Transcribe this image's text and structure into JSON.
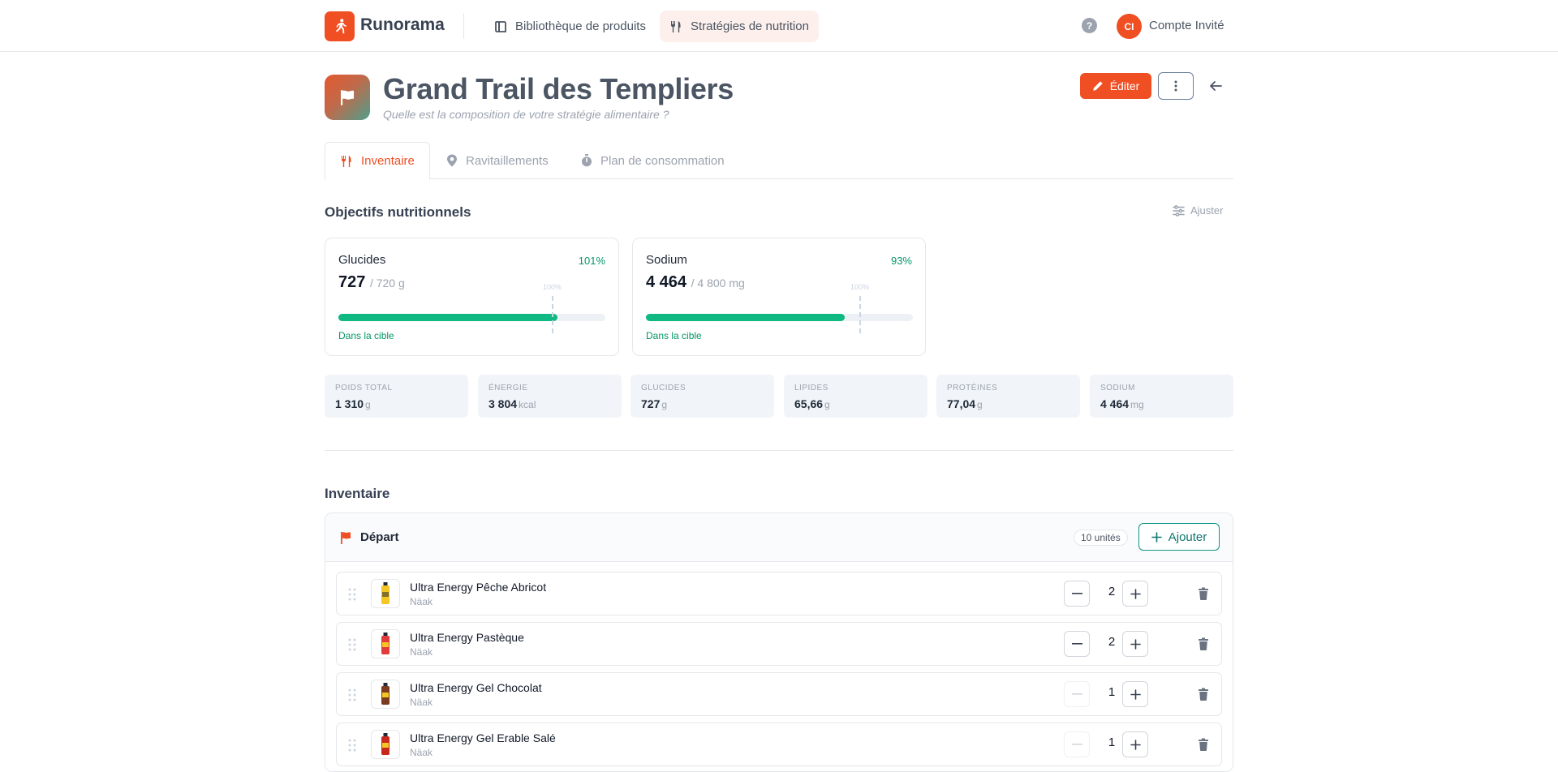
{
  "app": {
    "brand": "Runorama"
  },
  "nav": [
    {
      "label": "Bibliothèque de produits",
      "icon": "book-icon",
      "active": false
    },
    {
      "label": "Stratégies de nutrition",
      "icon": "utensils-icon",
      "active": true
    }
  ],
  "user": {
    "initials": "CI",
    "name": "Compte Invité",
    "help": "?"
  },
  "page": {
    "title": "Grand Trail des Templiers",
    "subtitle": "Quelle est la composition de votre stratégie alimentaire ?",
    "edit_label": "Éditer"
  },
  "tabs": [
    {
      "label": "Inventaire",
      "icon": "utensils-icon",
      "active": true
    },
    {
      "label": "Ravitaillements",
      "icon": "map-pin-icon",
      "active": false
    },
    {
      "label": "Plan de consommation",
      "icon": "stopwatch-icon",
      "active": false
    }
  ],
  "objectives": {
    "title": "Objectifs nutritionnels",
    "adjust_label": "Ajuster",
    "cards": [
      {
        "name": "Glucides",
        "pct": "101%",
        "value": "727",
        "target": "/ 720 g",
        "tick": "100%",
        "progress": 0.82,
        "status": "Dans la cible"
      },
      {
        "name": "Sodium",
        "pct": "93%",
        "value": "4 464",
        "target": "/ 4 800 mg",
        "tick": "100%",
        "progress": 0.745,
        "status": "Dans la cible"
      }
    ]
  },
  "stats": [
    {
      "label": "Poids total",
      "value": "1 310",
      "unit": "g"
    },
    {
      "label": "Énergie",
      "value": "3 804",
      "unit": "kcal"
    },
    {
      "label": "Glucides",
      "value": "727",
      "unit": "g"
    },
    {
      "label": "Lipides",
      "value": "65,66",
      "unit": "g"
    },
    {
      "label": "Protéines",
      "value": "77,04",
      "unit": "g"
    },
    {
      "label": "Sodium",
      "value": "4 464",
      "unit": "mg"
    }
  ],
  "inventory": {
    "title": "Inventaire",
    "group": {
      "name": "Départ",
      "units": "10 unités",
      "add_label": "Ajouter"
    },
    "items": [
      {
        "name": "Ultra Energy Pêche Abricot",
        "brand": "Näak",
        "qty": "2",
        "minus_enabled": true,
        "color": "#f3c623"
      },
      {
        "name": "Ultra Energy Pastèque",
        "brand": "Näak",
        "qty": "2",
        "minus_enabled": true,
        "color": "#e23b3b"
      },
      {
        "name": "Ultra Energy Gel Chocolat",
        "brand": "Näak",
        "qty": "1",
        "minus_enabled": false,
        "color": "#7a3b1e"
      },
      {
        "name": "Ultra Energy Gel Erable Salé",
        "brand": "Näak",
        "qty": "1",
        "minus_enabled": false,
        "color": "#c8281e"
      }
    ]
  },
  "colors": {
    "accent": "#f04e23",
    "success": "#10b981",
    "teal": "#0d9488"
  }
}
